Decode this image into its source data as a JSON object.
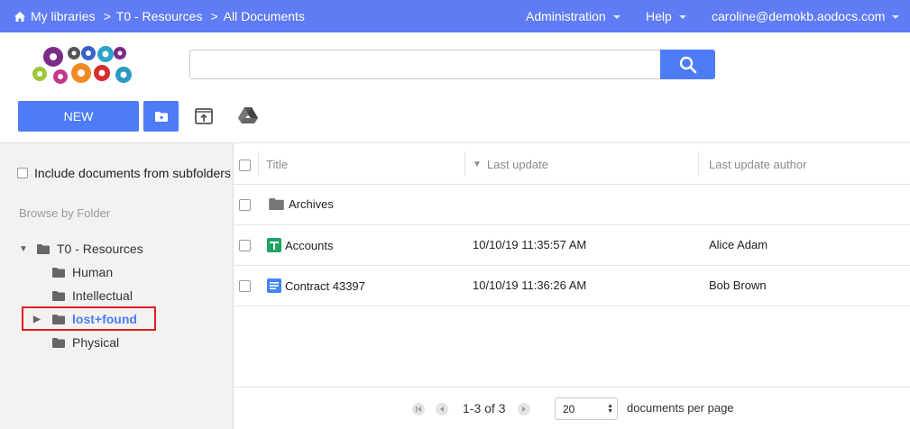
{
  "topbar": {
    "breadcrumb": [
      "My libraries",
      "T0 - Resources",
      "All Documents"
    ],
    "separator": ">",
    "menu": {
      "administration": "Administration",
      "help": "Help",
      "user": "caroline@demokb.aodocs.com"
    },
    "color": "#5f7cf4"
  },
  "search": {
    "value": "",
    "placeholder": ""
  },
  "toolbar": {
    "new_label": "NEW",
    "accent": "#4d7cf6"
  },
  "sidebar": {
    "include_subfolders_label": "Include documents from subfolders",
    "include_subfolders_checked": false,
    "browse_label": "Browse by Folder",
    "tree": [
      {
        "label": "T0 - Resources",
        "level": 0,
        "expander": "▼",
        "active": false
      },
      {
        "label": "Human",
        "level": 1,
        "expander": "",
        "active": false
      },
      {
        "label": "Intellectual",
        "level": 1,
        "expander": "",
        "active": false
      },
      {
        "label": "lost+found",
        "level": 1,
        "expander": "▶",
        "active": true
      },
      {
        "label": "Physical",
        "level": 1,
        "expander": "",
        "active": false
      }
    ]
  },
  "table": {
    "columns": {
      "title": "Title",
      "last_update": "Last update",
      "author": "Last update author"
    },
    "sort_indicator": "▼",
    "rows": [
      {
        "type": "folder",
        "icon": "folder-icon",
        "title": "Archives",
        "last_update": "",
        "author": ""
      },
      {
        "type": "sheet",
        "icon": "google-sheets-icon",
        "title": "Accounts",
        "last_update": "10/10/19 11:35:57 AM",
        "author": "Alice Adam"
      },
      {
        "type": "doc",
        "icon": "google-docs-icon",
        "title": "Contract 43397",
        "last_update": "10/10/19 11:36:26 AM",
        "author": "Bob Brown"
      }
    ]
  },
  "pagination": {
    "range": "1-3 of 3",
    "per_page": "20",
    "per_page_label": "documents per page"
  }
}
